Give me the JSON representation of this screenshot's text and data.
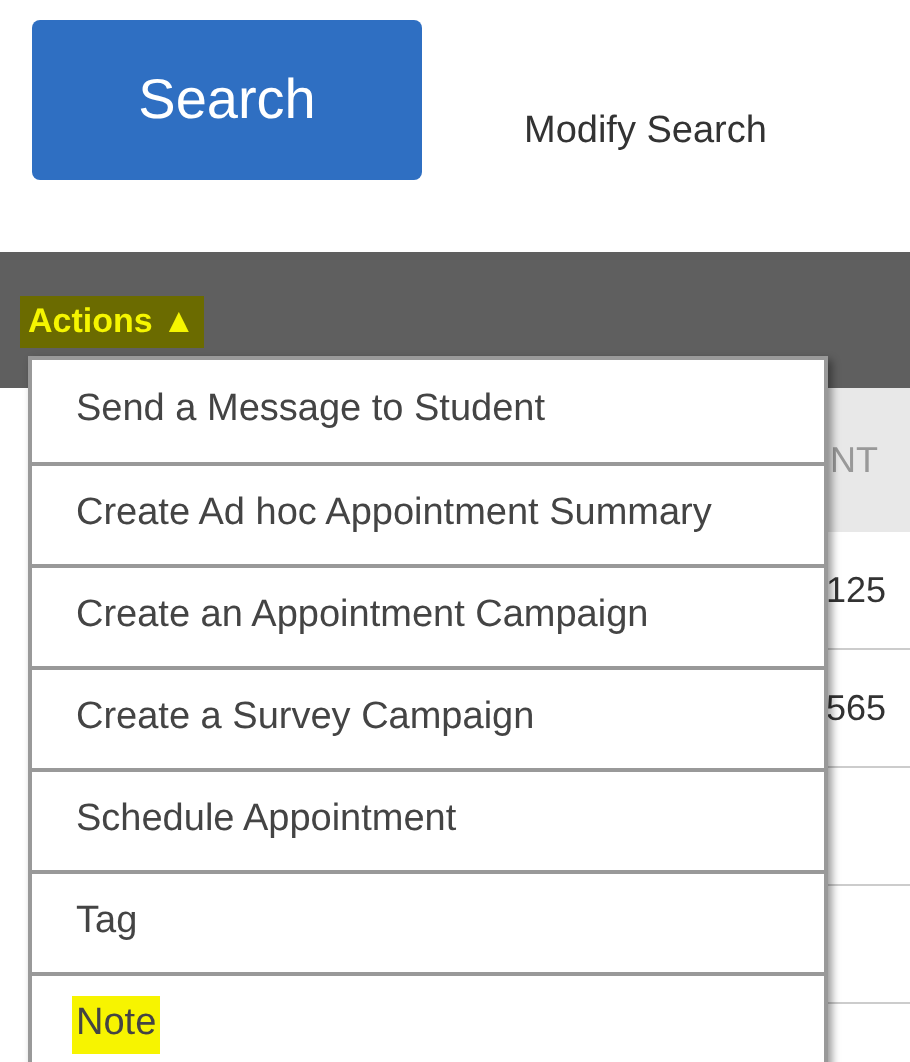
{
  "search_button": "Search",
  "modify_search_link": "Modify Search",
  "actions_menu": {
    "label": "Actions ▲",
    "expanded": true,
    "highlighted": true,
    "items": [
      {
        "label": "Send a Message to Student",
        "highlighted": false
      },
      {
        "label": "Create Ad hoc Appointment Summary",
        "highlighted": false
      },
      {
        "label": "Create an Appointment Campaign",
        "highlighted": false
      },
      {
        "label": "Create a Survey Campaign",
        "highlighted": false
      },
      {
        "label": "Schedule Appointment",
        "highlighted": false
      },
      {
        "label": "Tag",
        "highlighted": false
      },
      {
        "label": "Note",
        "highlighted": true
      }
    ]
  },
  "table": {
    "columns": [
      "NT"
    ],
    "rows": [
      [
        "125"
      ],
      [
        "565"
      ],
      [
        ""
      ],
      [
        ""
      ]
    ]
  }
}
